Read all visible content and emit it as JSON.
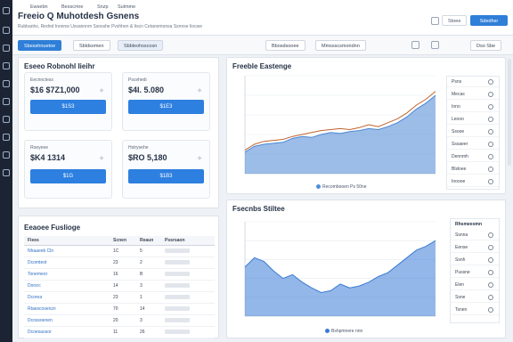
{
  "app": {
    "title": "Freeio Q Muhotdesh Gsnens",
    "breadcrumb": "Rubbanhs, Rednd Inonnw Ussannnm Ssnsshe Pvshhen & Iiscn Cetanomonsa Sxnnse Iiocwe",
    "nav": [
      "Ewsebn",
      "Besscmre",
      "Snzp",
      "Sulmme"
    ],
    "top_actions": {
      "user_label": "Stoee",
      "primary_label": "Sdedhsr"
    }
  },
  "toolbar": {
    "buttons": [
      "Sbesshnuetoe",
      "Sbldsomen",
      "Sbbleohsscosn"
    ],
    "right_buttons": [
      "Bbosdsooee",
      "Mmssscsmondnn"
    ],
    "far_right": "Dso Sbe"
  },
  "kpi_panel": {
    "title": "Eseeo Robnohl Iieihr",
    "cards": [
      {
        "label": "Eecnnctess",
        "value": "$16 $7Z1,000",
        "bar_label": "$1S3"
      },
      {
        "label": "Pscehedi",
        "value": "$4I. 5.080",
        "bar_label": "$1E3"
      },
      {
        "label": "Roeyeee",
        "value": "$K4 1314",
        "bar_label": "$1G"
      },
      {
        "label": "Hstrysehe",
        "value": "$RO 5,180",
        "bar_label": "$1B3"
      }
    ]
  },
  "table_panel": {
    "title": "Eeaoee Fuslioge",
    "columns": [
      "Fiees",
      "Scnen",
      "Reaun",
      "Pssrsaon"
    ],
    "rows": [
      [
        "Nhaaeeb Cln",
        "1C",
        "5",
        ""
      ],
      [
        "Dcomteot",
        "23",
        "2",
        ""
      ],
      [
        "Tonemeor",
        "16",
        "B",
        ""
      ],
      [
        "Dorsrc",
        "14",
        "3",
        ""
      ],
      [
        "Dcorea",
        "23",
        "1",
        ""
      ],
      [
        "Rtaescosenzn",
        "70",
        "14",
        ""
      ],
      [
        "Dcossoenen",
        "20",
        "3",
        ""
      ],
      [
        "Dcoesaosor",
        "11",
        "26",
        ""
      ]
    ]
  },
  "chart1_panel": {
    "title": "Freeble Eastenge",
    "legend": [
      "Recombooen Ps 50ne"
    ],
    "side_items": [
      "Psns",
      "Mecas",
      "Inno",
      "Leooo",
      "Ssooe",
      "Sssaeer",
      "Dennmh",
      "Blsloee",
      "Inoooe"
    ]
  },
  "chart2_panel": {
    "title": "Fsecnbs Stiltee",
    "legend": [
      "Bshpmnere nnn"
    ],
    "side_title": "Rhsmeeomn",
    "side_items": [
      "Ssnna",
      "Eense",
      "Ssnh",
      "Pussne",
      "Elen",
      "Ssne",
      "Tsnen"
    ]
  },
  "chart_data": [
    {
      "type": "line",
      "title": "Freeble Eastenge",
      "ylim": [
        0,
        100
      ],
      "x": [
        0,
        1,
        2,
        3,
        4,
        5,
        6,
        7,
        8,
        9,
        10,
        11,
        12,
        13,
        14,
        15,
        16,
        17,
        18,
        19,
        20
      ],
      "series": [
        {
          "name": "Recombooen Ps 50ne",
          "values": [
            22,
            28,
            30,
            31,
            32,
            36,
            38,
            37,
            40,
            42,
            41,
            43,
            44,
            46,
            45,
            48,
            52,
            58,
            66,
            72,
            80
          ],
          "color": "#4a86d6",
          "area": true
        },
        {
          "values": [
            24,
            30,
            33,
            34,
            35,
            38,
            40,
            42,
            44,
            45,
            46,
            45,
            47,
            50,
            48,
            52,
            56,
            62,
            70,
            76,
            84
          ],
          "color": "#c0632c",
          "area": false
        }
      ],
      "grid": true,
      "legend_position": "bottom"
    },
    {
      "type": "area",
      "title": "Fsecnbs Stiltee",
      "ylim": [
        0,
        100
      ],
      "x": [
        0,
        1,
        2,
        3,
        4,
        5,
        6,
        7,
        8,
        9,
        10,
        11,
        12,
        13,
        14,
        15,
        16,
        17,
        18,
        19,
        20
      ],
      "series": [
        {
          "name": "Bshpmnere nnn",
          "values": [
            52,
            62,
            58,
            48,
            40,
            44,
            36,
            30,
            25,
            27,
            34,
            30,
            32,
            36,
            42,
            46,
            54,
            62,
            70,
            74,
            80
          ],
          "color": "#3a7bd5"
        }
      ],
      "grid": true,
      "legend_position": "bottom"
    }
  ]
}
